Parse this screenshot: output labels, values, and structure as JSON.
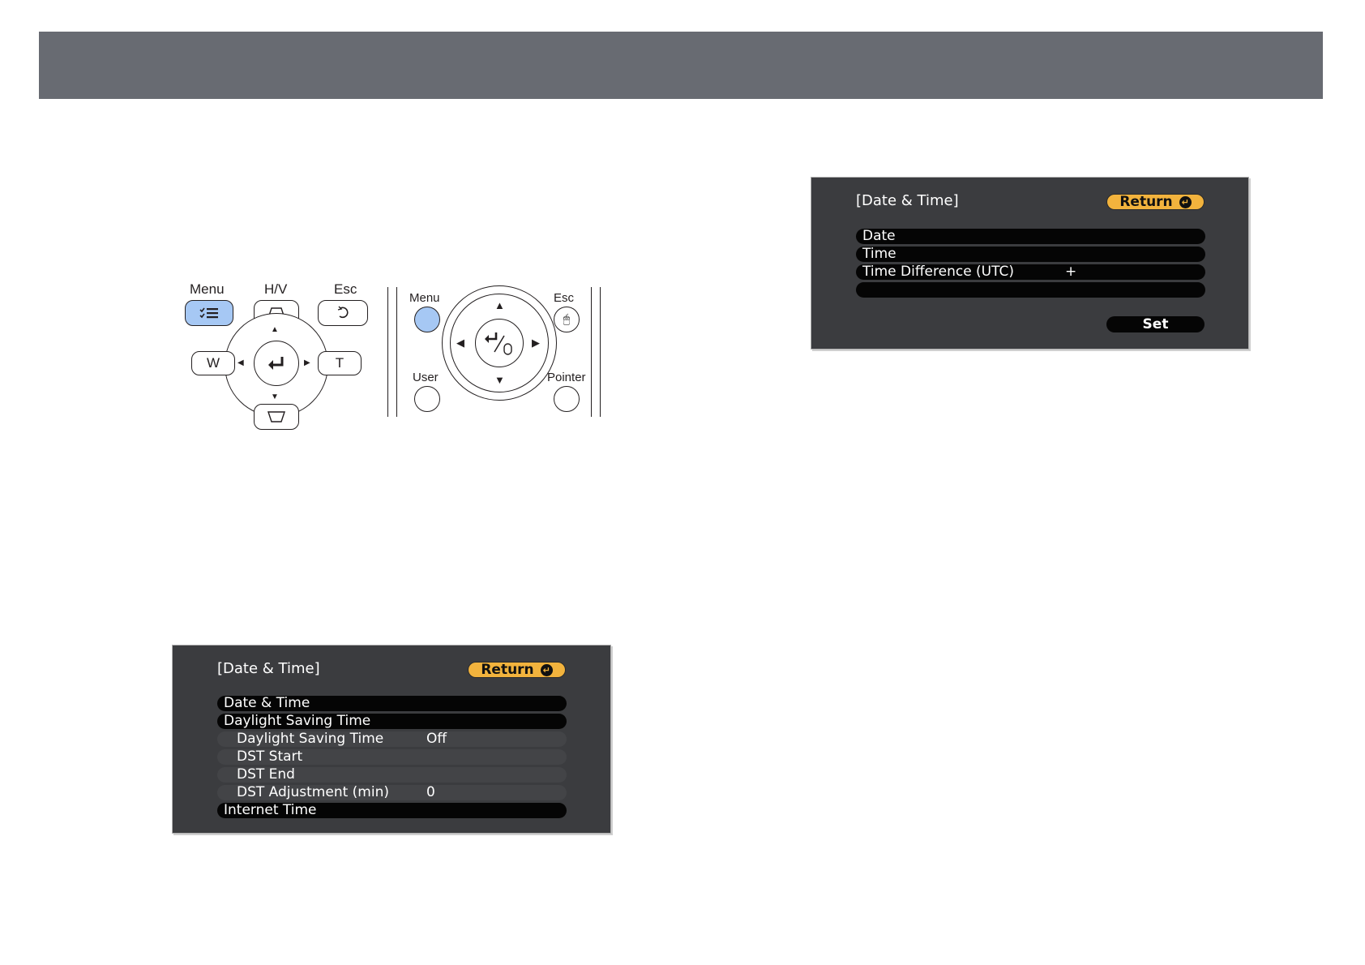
{
  "remote_a": {
    "menu_label": "Menu",
    "hv_label": "H/V",
    "esc_label": "Esc",
    "w_label": "W",
    "t_label": "T",
    "highlight_color": "#a6c8f4"
  },
  "remote_b": {
    "menu_label": "Menu",
    "esc_label": "Esc",
    "user_label": "User",
    "pointer_label": "Pointer"
  },
  "osd_top": {
    "title": "[Date & Time]",
    "return_label": "Return",
    "rows": [
      {
        "label": "Date",
        "value": ""
      },
      {
        "label": "Time",
        "value": ""
      },
      {
        "label": "Time Difference (UTC)",
        "value": "+"
      },
      {
        "label": "",
        "value": ""
      }
    ],
    "set_label": "Set"
  },
  "osd_bottom": {
    "title": "[Date & Time]",
    "return_label": "Return",
    "rows": [
      {
        "label": "Date & Time",
        "value": "",
        "type": "main"
      },
      {
        "label": "Daylight Saving Time",
        "value": "",
        "type": "main"
      },
      {
        "label": "Daylight Saving Time",
        "value": "Off",
        "type": "sub"
      },
      {
        "label": "DST Start",
        "value": "",
        "type": "sub"
      },
      {
        "label": "DST End",
        "value": "",
        "type": "sub"
      },
      {
        "label": "DST Adjustment (min)",
        "value": "0",
        "type": "sub"
      },
      {
        "label": "Internet Time",
        "value": "",
        "type": "main"
      }
    ]
  },
  "colors": {
    "header_bar": "#686b72",
    "osd_background": "#3b3c3f",
    "return_button": "#f2b33d"
  }
}
